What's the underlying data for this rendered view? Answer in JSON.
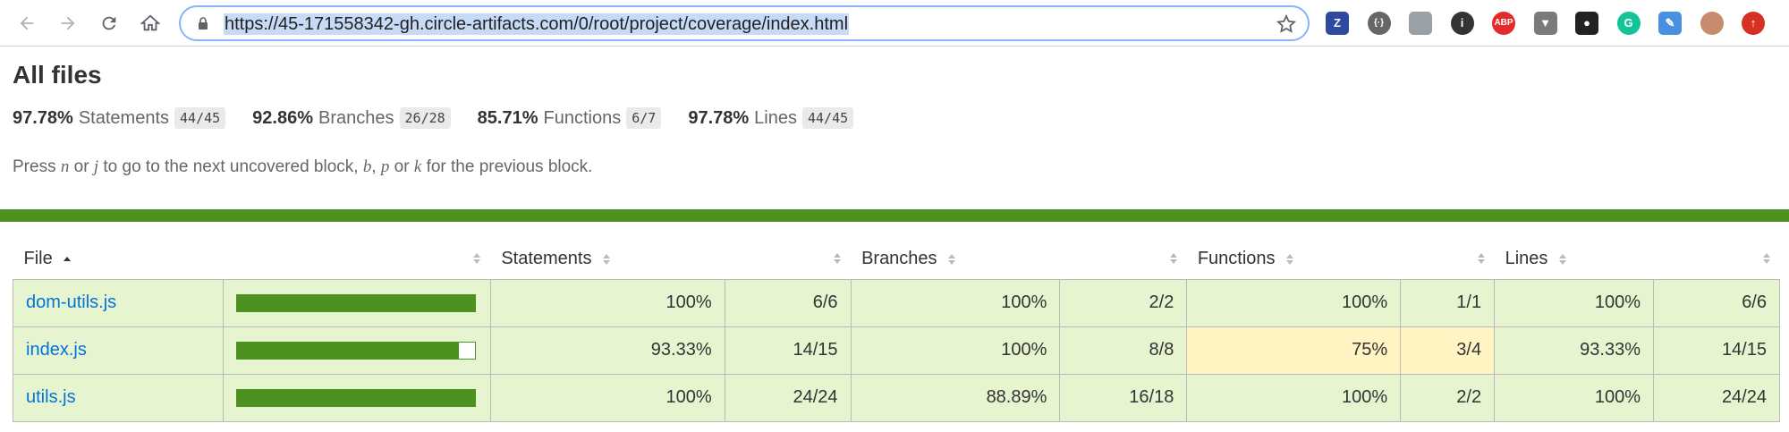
{
  "browser": {
    "url": "https://45-171558342-gh.circle-artifacts.com/0/root/project/coverage/index.html",
    "extensions": [
      {
        "name": "zotero-icon",
        "glyph": "Z",
        "color": "#2e4a9e"
      },
      {
        "name": "code-brackets-icon",
        "glyph": "{·}",
        "color": "#666666"
      },
      {
        "name": "document-icon",
        "glyph": "",
        "color": "#9aa0a6"
      },
      {
        "name": "info-icon",
        "glyph": "i",
        "color": "#333333"
      },
      {
        "name": "adblock-plus-icon",
        "glyph": "ABP",
        "color": "#e32b2b"
      },
      {
        "name": "vue-devtools-icon",
        "glyph": "▼",
        "color": "#7a7a7a"
      },
      {
        "name": "octocat-icon",
        "glyph": "●",
        "color": "#222222"
      },
      {
        "name": "grammarly-icon",
        "glyph": "G",
        "color": "#15c39a"
      },
      {
        "name": "feather-icon",
        "glyph": "✎",
        "color": "#4a90e2"
      },
      {
        "name": "profile-avatar-icon",
        "glyph": "",
        "color": "#c78c6d"
      },
      {
        "name": "update-icon",
        "glyph": "↑",
        "color": "#d93025"
      }
    ]
  },
  "page": {
    "title": "All files",
    "summary": [
      {
        "pct": "97.78%",
        "label": "Statements",
        "fraction": "44/45"
      },
      {
        "pct": "92.86%",
        "label": "Branches",
        "fraction": "26/28"
      },
      {
        "pct": "85.71%",
        "label": "Functions",
        "fraction": "6/7"
      },
      {
        "pct": "97.78%",
        "label": "Lines",
        "fraction": "44/45"
      }
    ],
    "hint": {
      "t1": "Press ",
      "k1": "n",
      "t2": " or ",
      "k2": "j",
      "t3": " to go to the next uncovered block, ",
      "k3": "b",
      "t4": ", ",
      "k4": "p",
      "t5": " or ",
      "k5": "k",
      "t6": " for the previous block."
    },
    "status_color": "#4d9221"
  },
  "table": {
    "headers": {
      "file": "File",
      "statements": "Statements",
      "branches": "Branches",
      "functions": "Functions",
      "lines": "Lines"
    },
    "rows": [
      {
        "file": "dom-utils.js",
        "coverage": 1.0,
        "stmt_pct": "100%",
        "stmt_frac": "6/6",
        "br_pct": "100%",
        "br_frac": "2/2",
        "fn_pct": "100%",
        "fn_frac": "1/1",
        "ln_pct": "100%",
        "ln_frac": "6/6",
        "fn_level": "high"
      },
      {
        "file": "index.js",
        "coverage": 0.9333,
        "stmt_pct": "93.33%",
        "stmt_frac": "14/15",
        "br_pct": "100%",
        "br_frac": "8/8",
        "fn_pct": "75%",
        "fn_frac": "3/4",
        "ln_pct": "93.33%",
        "ln_frac": "14/15",
        "fn_level": "medium"
      },
      {
        "file": "utils.js",
        "coverage": 1.0,
        "stmt_pct": "100%",
        "stmt_frac": "24/24",
        "br_pct": "88.89%",
        "br_frac": "16/18",
        "fn_pct": "100%",
        "fn_frac": "2/2",
        "ln_pct": "100%",
        "ln_frac": "24/24",
        "fn_level": "high"
      }
    ]
  }
}
